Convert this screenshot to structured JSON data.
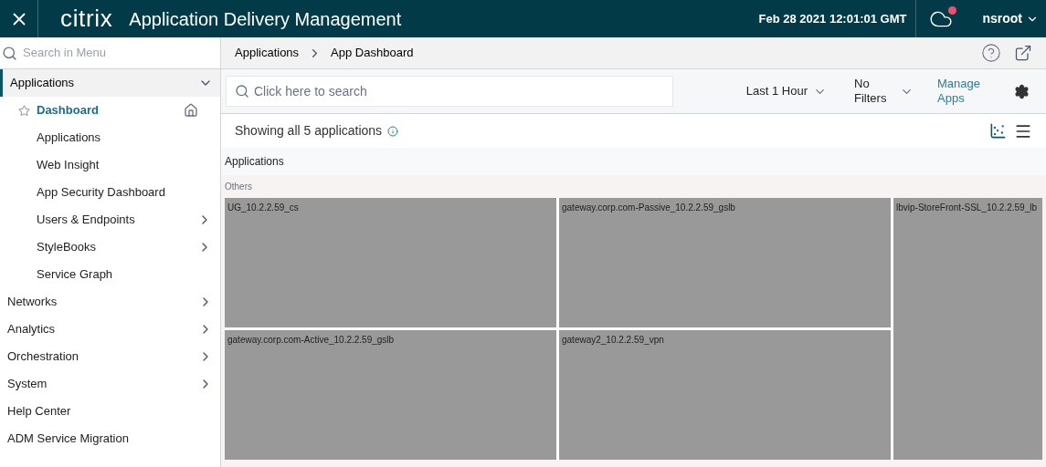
{
  "header": {
    "logo": "citrix",
    "title": "Application Delivery Management",
    "datetime": "Feb 28 2021 12:01:01 GMT",
    "notification": true,
    "user": "nsroot"
  },
  "sidebar": {
    "search": {
      "placeholder": "Search in Menu"
    },
    "items": [
      {
        "label": "Applications",
        "expanded": true,
        "has_submenu": true,
        "children": [
          {
            "label": "Dashboard",
            "selected": true,
            "has_submenu": false
          },
          {
            "label": "Applications",
            "selected": false,
            "has_submenu": false
          },
          {
            "label": "Web Insight",
            "selected": false,
            "has_submenu": false
          },
          {
            "label": "App Security Dashboard",
            "selected": false,
            "has_submenu": false
          },
          {
            "label": "Users & Endpoints",
            "selected": false,
            "has_submenu": true
          },
          {
            "label": "StyleBooks",
            "selected": false,
            "has_submenu": true
          },
          {
            "label": "Service Graph",
            "selected": false,
            "has_submenu": false
          }
        ]
      },
      {
        "label": "Networks",
        "expanded": false,
        "has_submenu": true
      },
      {
        "label": "Analytics",
        "expanded": false,
        "has_submenu": true
      },
      {
        "label": "Orchestration",
        "expanded": false,
        "has_submenu": true
      },
      {
        "label": "System",
        "expanded": false,
        "has_submenu": true
      },
      {
        "label": "Help Center",
        "expanded": false,
        "has_submenu": false
      },
      {
        "label": "ADM Service Migration",
        "expanded": false,
        "has_submenu": false
      }
    ]
  },
  "breadcrumb": [
    "Applications",
    "App Dashboard"
  ],
  "toolbar": {
    "search": {
      "placeholder": "Click here to search"
    },
    "time_range": "Last 1 Hour",
    "filters": "No Filters",
    "manage": "Manage Apps"
  },
  "summary": "Showing all 5 applications",
  "treemap": {
    "title": "Applications",
    "group": "Others",
    "tiles": [
      {
        "label": "UG_10.2.2.59_cs"
      },
      {
        "label": "gateway.corp.com-Passive_10.2.2.59_gslb"
      },
      {
        "label": "lbvip-StoreFront-SSL_10.2.2.59_lb"
      },
      {
        "label": "gateway.corp.com-Active_10.2.2.59_gslb"
      },
      {
        "label": "gateway2_10.2.2.59_vpn"
      }
    ]
  }
}
